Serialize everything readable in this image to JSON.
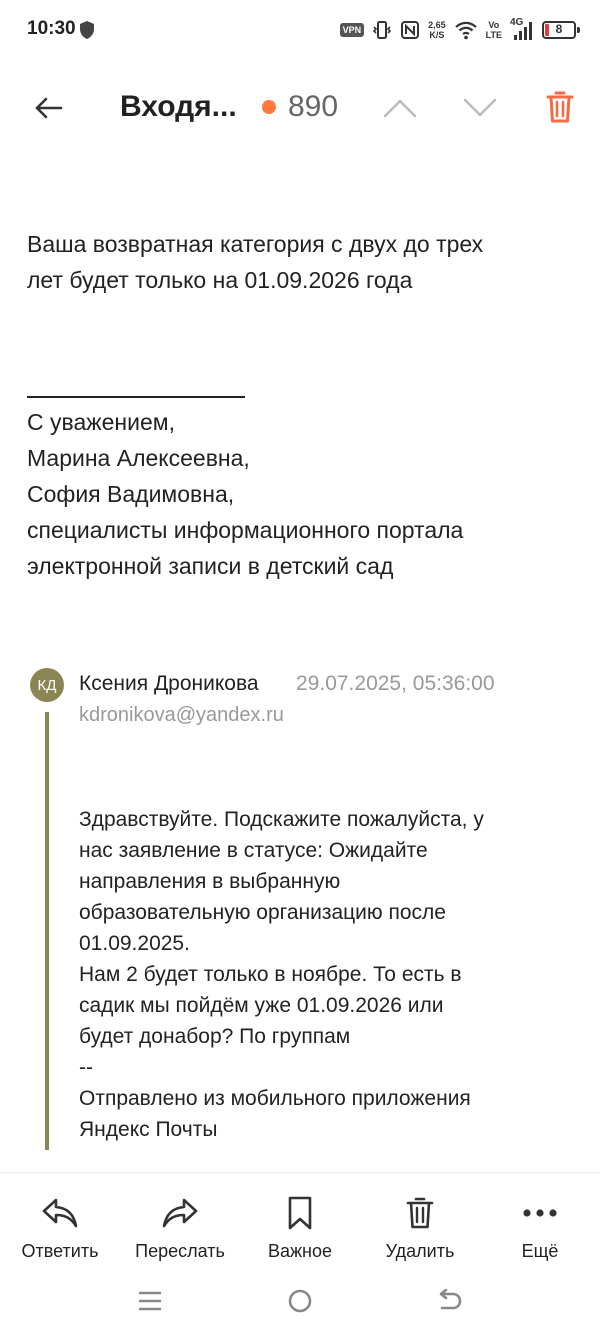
{
  "status_bar": {
    "time": "10:30",
    "vpn": "VPN",
    "speed_value": "2,65",
    "speed_unit": "K/S",
    "volte_top": "Vo",
    "volte_bottom": "LTE",
    "network": "4G",
    "battery": "8"
  },
  "header": {
    "folder": "Входя...",
    "unread_count": "890",
    "dot_color": "#ff7a3d",
    "trash_color": "#f36a45"
  },
  "message": {
    "body_lines": [
      "Ваша возвратная категория с двух до трех",
      "лет будет только  на 01.09.2026 года"
    ],
    "signature_lines": [
      "С уважением,",
      "Марина Алексеевна,",
      "София Вадимовна,",
      "специалисты информационного портала",
      "электронной записи в детский сад"
    ]
  },
  "quote": {
    "avatar_initials": "КД",
    "avatar_color": "#8a8653",
    "sender": "Ксения Дроникова",
    "date": "29.07.2025, 05:36:00",
    "email": "kdronikova@yandex.ru",
    "lines": [
      "Здравствуйте. Подскажите пожалуйста, у",
      "нас заявление в статусе: Ожидайте",
      "направления в выбранную",
      "образовательную организацию после",
      "01.09.2025.",
      "Нам 2 будет только в ноябре. То есть в",
      "садик мы пойдём уже 01.09.2026 или",
      "будет донабор? По группам",
      "--",
      "Отправлено из мобильного приложения",
      "Яндекс Почты"
    ]
  },
  "toolbar": {
    "reply": "Ответить",
    "forward": "Переслать",
    "important": "Важное",
    "delete": "Удалить",
    "more": "Ещё"
  }
}
